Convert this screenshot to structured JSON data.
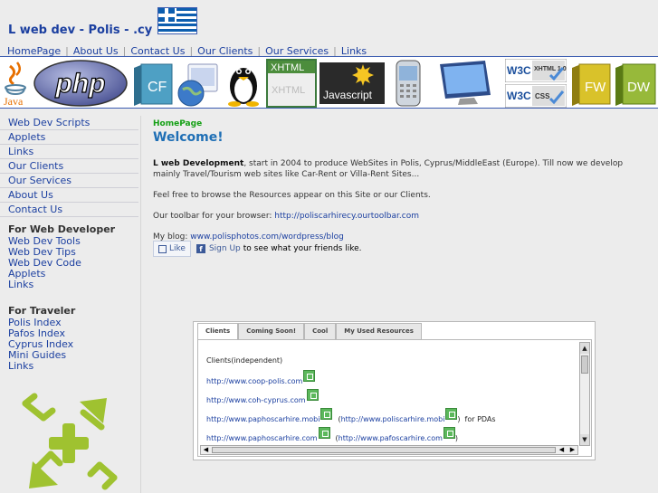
{
  "header": {
    "title": "L web dev - Polis - .cy"
  },
  "nav": {
    "items": [
      "HomePage",
      "About Us",
      "Contact Us",
      "Our Clients",
      "Our Services",
      "Links"
    ],
    "separator": "|"
  },
  "banner": {
    "java": "Java",
    "php": "php",
    "cf": "CF",
    "xhtml": "XHTML",
    "javascript": "Javascript",
    "w3c": "W3C",
    "xhtml10": "XHTML 1.0",
    "css": "CSS",
    "fw": "FW",
    "dw": "DW"
  },
  "sidebar": {
    "links": [
      "Web Dev Scripts",
      "Applets",
      "Links",
      "Our Clients",
      "Our Services",
      "About Us",
      "Contact Us"
    ],
    "groups": [
      {
        "heading": "For Web Developer",
        "links": [
          "Web Dev Tools",
          "Web Dev Tips",
          "Web Dev Code",
          "Applets",
          "Links"
        ]
      },
      {
        "heading": "For Traveler",
        "links": [
          "Polis Index",
          "Pafos Index",
          "Cyprus Index",
          "Mini Guides",
          "Links"
        ]
      }
    ]
  },
  "content": {
    "breadcrumb": "HomePage",
    "heading": "Welcome!",
    "intro_bold": "L web Development",
    "intro_rest": ", start in 2004 to produce WebSites in Polis, Cyprus/MiddleEast (Europe). Till now we develop mainly Travel/Tourism web sites like Car-Rent or Villa-Rent Sites...",
    "browse": "Feel free to browse the Resources appear on this Site or our Clients.",
    "toolbar_label": "Our toolbar for your browser: ",
    "toolbar_url": "http://poliscarhirecy.ourtoolbar.com",
    "blog_label": "My blog: ",
    "blog_url": "www.polisphotos.com/wordpress/blog",
    "like_label": "Like",
    "signup_label": "Sign Up",
    "like_tail": "to see what your friends like."
  },
  "tabs": {
    "labels": [
      "Clients",
      "Coming Soon!",
      "Cool",
      "My Used Resources"
    ],
    "active": "Clients",
    "panel": {
      "heading": "Clients(independent)",
      "rows": [
        {
          "url": "http://www.coop-polis.com"
        },
        {
          "url": "http://www.coh-cyprus.com"
        },
        {
          "url": "http://www.paphoscarhire.mobi",
          "alt": "http://www.poliscarhire.mobi",
          "suffix": "for PDAs"
        },
        {
          "url": "http://www.paphoscarhire.com",
          "alt": "http://www.pafoscarhire.com",
          "suffix": ""
        }
      ]
    }
  },
  "colors": {
    "link": "#1b3fa0",
    "heading": "#1f6fb5",
    "breadcrumb": "#15a015",
    "background": "#ececec",
    "logo_green": "#9fc230"
  }
}
